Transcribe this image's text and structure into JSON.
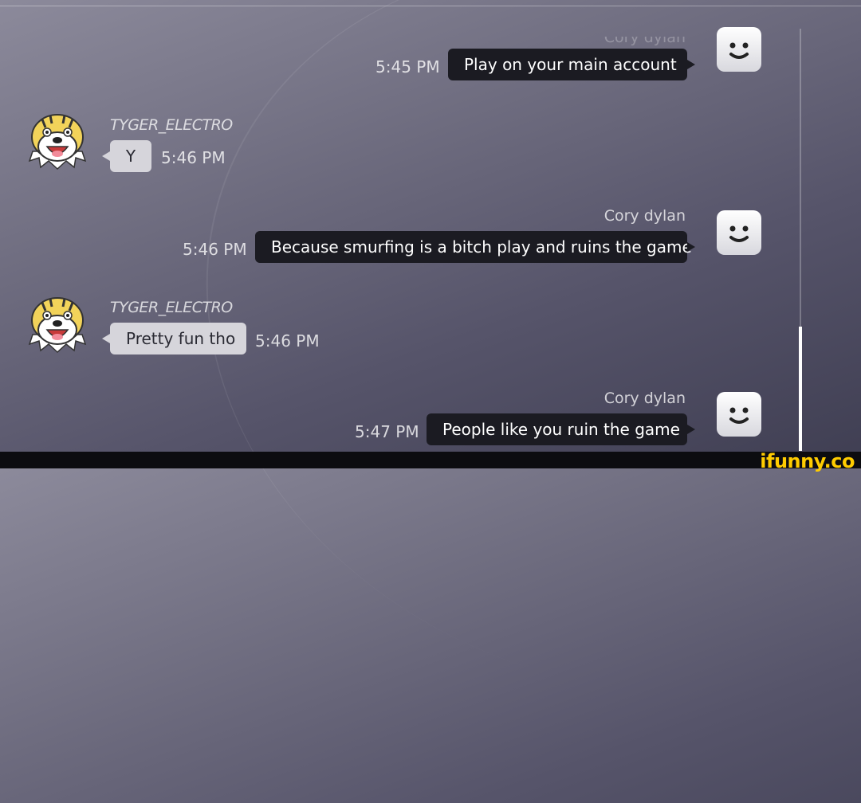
{
  "messages": [
    {
      "sender": "self",
      "name": "Cory dylan",
      "time": "5:45 PM",
      "text": "Play on your main account"
    },
    {
      "sender": "other",
      "name": "TYGER_ELECTRO",
      "time": "5:46 PM",
      "text": "Y"
    },
    {
      "sender": "self",
      "name": "Cory dylan",
      "time": "5:46 PM",
      "text": "Because smurfing is a bitch play and ruins the game"
    },
    {
      "sender": "other",
      "name": "TYGER_ELECTRO",
      "time": "5:46 PM",
      "text": "Pretty fun tho"
    },
    {
      "sender": "self",
      "name": "Cory dylan",
      "time": "5:47 PM",
      "text": "People like you ruin the game"
    }
  ],
  "watermark": "ifunny.co",
  "colors": {
    "logo": "#ffcc00",
    "self_bubble": "#1b1b22",
    "other_bubble": "#d6d5db"
  }
}
